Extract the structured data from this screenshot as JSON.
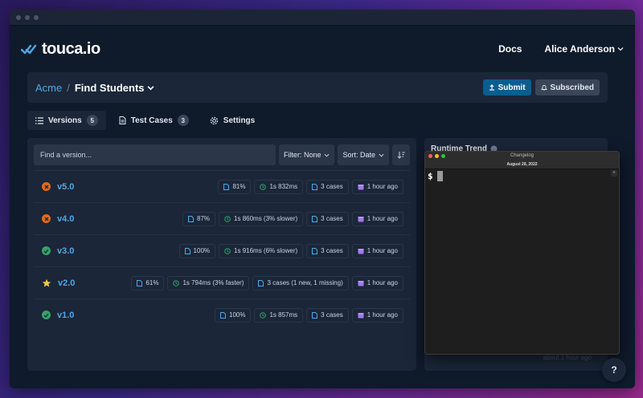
{
  "navbar": {
    "logo_text": "touca.io",
    "docs_label": "Docs",
    "user_name": "Alice Anderson"
  },
  "header": {
    "team": "Acme",
    "separator": "/",
    "suite": "Find Students",
    "submit_label": "Submit",
    "subscribed_label": "Subscribed"
  },
  "tabs": [
    {
      "label": "Versions",
      "count": "5"
    },
    {
      "label": "Test Cases",
      "count": "3"
    },
    {
      "label": "Settings"
    }
  ],
  "versions_panel": {
    "search_placeholder": "Find a version...",
    "filter_label": "Filter: None",
    "sort_label": "Sort: Date",
    "rows": [
      {
        "name": "v5.0",
        "status": "failed",
        "score": "81%",
        "runtime": "1s 832ms",
        "cases": "3 cases",
        "time": "1 hour ago"
      },
      {
        "name": "v4.0",
        "status": "failed",
        "score": "87%",
        "runtime": "1s 860ms (3% slower)",
        "cases": "3 cases",
        "time": "1 hour ago"
      },
      {
        "name": "v3.0",
        "status": "passed",
        "score": "100%",
        "runtime": "1s 916ms (6% slower)",
        "cases": "3 cases",
        "time": "1 hour ago"
      },
      {
        "name": "v2.0",
        "status": "baseline",
        "score": "61%",
        "runtime": "1s 794ms (3% faster)",
        "cases": "3 cases (1 new, 1 missing)",
        "time": "1 hour ago"
      },
      {
        "name": "v1.0",
        "status": "passed",
        "score": "100%",
        "runtime": "1s 857ms",
        "cases": "3 cases",
        "time": "1 hour ago"
      }
    ]
  },
  "trend_panel": {
    "title": "Runtime Trend",
    "footer": "about 1 hour ago"
  },
  "terminal": {
    "title": "Changelog",
    "subtitle": "August 28, 2022",
    "prompt": "$"
  },
  "help": {
    "label": "?"
  },
  "colors": {
    "accent": "#4ea8e6",
    "failed": "#dd6b20",
    "passed": "#38a169",
    "baseline": "#ecc94b",
    "primary_button": "#0b5d8f"
  }
}
